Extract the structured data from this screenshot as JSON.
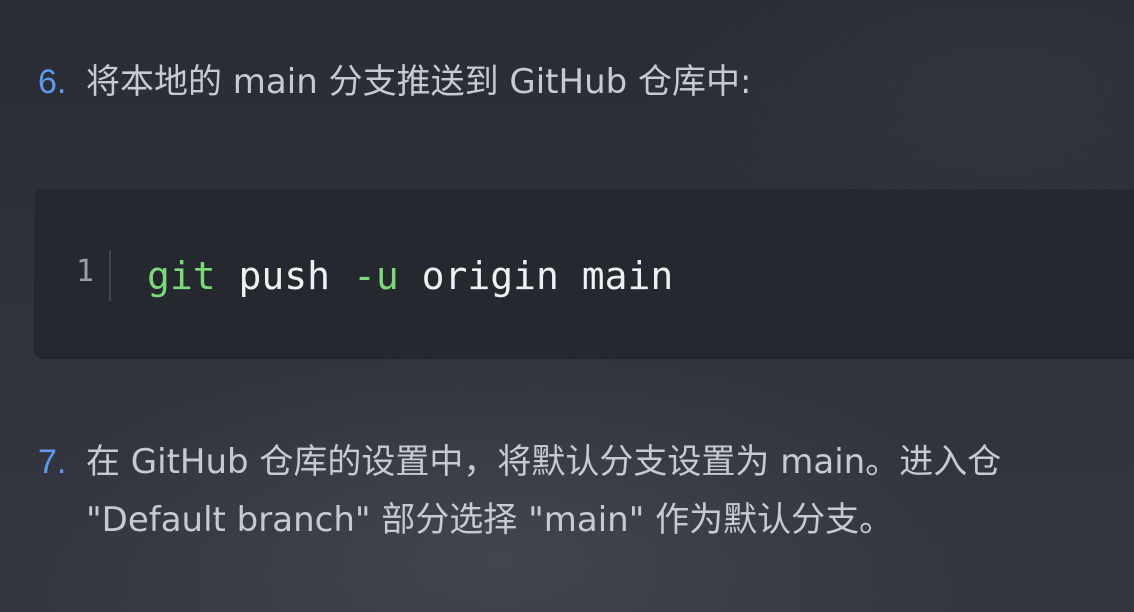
{
  "steps": [
    {
      "number": "6.",
      "lines": [
        "将本地的 main 分支推送到 GitHub 仓库中:"
      ]
    },
    {
      "number": "7.",
      "lines": [
        "在 GitHub 仓库的设置中，将默认分支设置为 main。进入仓",
        "\"Default branch\" 部分选择 \"main\" 作为默认分支。"
      ]
    }
  ],
  "code_block": {
    "line_number": "1",
    "tokens": {
      "cmd": "git",
      "sp1": " ",
      "sub": "push",
      "sp2": " ",
      "flag": "-u",
      "sp3": " ",
      "remote": "origin",
      "sp4": " ",
      "branch": "main"
    }
  }
}
